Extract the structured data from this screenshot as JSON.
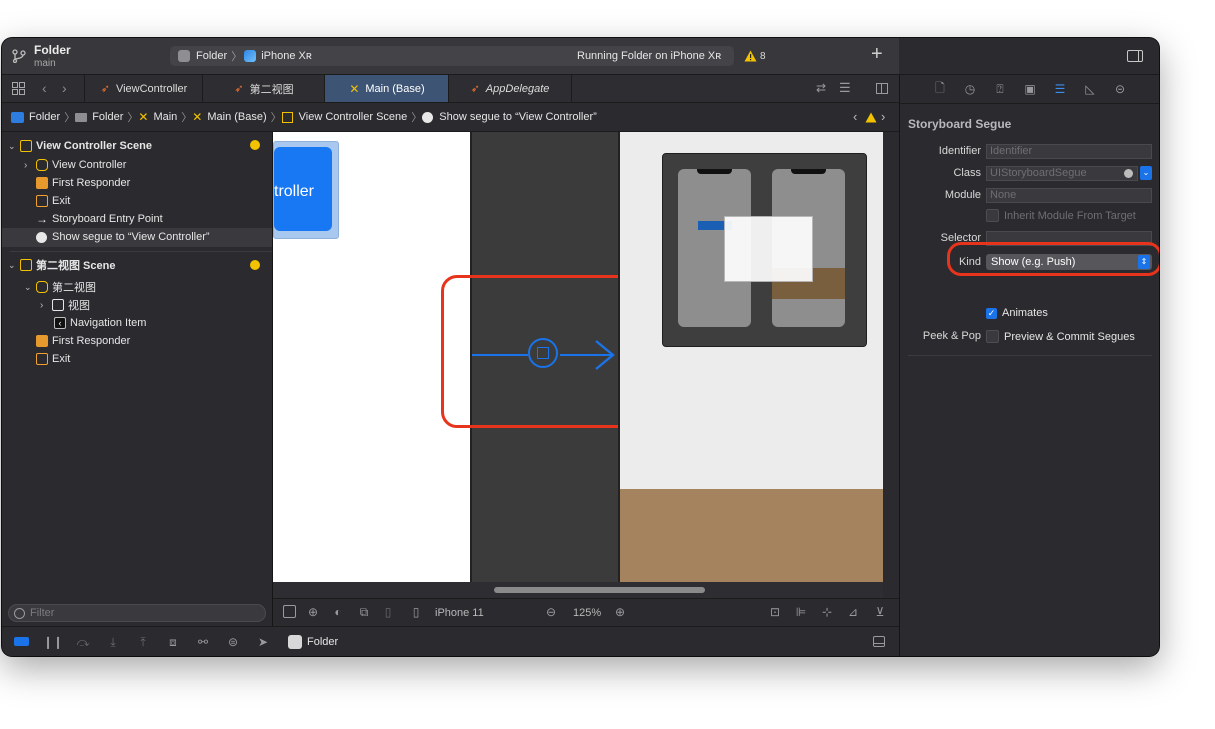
{
  "title_bar": {
    "project_name": "Folder",
    "branch": "main",
    "scheme": "Folder",
    "device": "iPhone Xʀ",
    "status": "Running Folder on iPhone Xʀ",
    "warning_count": "8"
  },
  "tabs": [
    {
      "label": "ViewController"
    },
    {
      "label": "第二视图"
    },
    {
      "label": "Main (Base)"
    },
    {
      "label": "AppDelegate"
    }
  ],
  "jump_bar": {
    "items": [
      "Folder",
      "Folder",
      "Main",
      "Main (Base)",
      "View Controller Scene",
      "Show segue to “View Controller”"
    ]
  },
  "outline": {
    "scene1": {
      "title": "View Controller Scene",
      "items": [
        "View Controller",
        "First Responder",
        "Exit",
        "Storyboard Entry Point",
        "Show segue to “View Controller”"
      ]
    },
    "scene2": {
      "title": "第二视图 Scene",
      "controller": "第二视图",
      "view": "视图",
      "nav_item": "Navigation Item",
      "first_responder": "First Responder",
      "exit": "Exit"
    },
    "filter_placeholder": "Filter"
  },
  "canvas": {
    "controller_text": "troller",
    "device_name": "iPhone 11",
    "zoom": "125%"
  },
  "debug_bar": {
    "target": "Folder"
  },
  "inspector": {
    "title": "Storyboard Segue",
    "identifier_label": "Identifier",
    "identifier_placeholder": "Identifier",
    "class_label": "Class",
    "class_value": "UIStoryboardSegue",
    "module_label": "Module",
    "module_value": "None",
    "inherit_label": "Inherit Module From Target",
    "selector_label": "Selector",
    "kind_label": "Kind",
    "kind_value": "Show (e.g. Push)",
    "animates_label": "Animates",
    "peek_label": "Peek & Pop",
    "peek_value": "Preview & Commit Segues"
  },
  "colors": {
    "accent": "#1a73e8",
    "highlight_ring": "#e8341c",
    "warning": "#f2c200",
    "canvas_brown": "#a5835e"
  }
}
